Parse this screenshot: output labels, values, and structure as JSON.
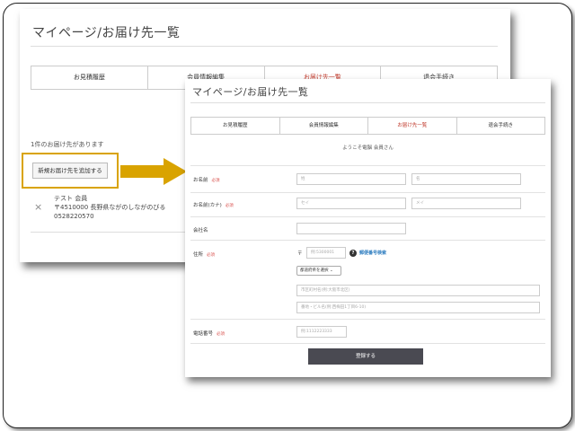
{
  "back": {
    "title": "マイページ/お届け先一覧",
    "tabs": [
      {
        "label": "お見積履歴",
        "active": false
      },
      {
        "label": "会員情報編集",
        "active": false
      },
      {
        "label": "お届け先一覧",
        "active": true
      },
      {
        "label": "退会手続き",
        "active": false
      }
    ],
    "count_text": "1件のお届け先があります",
    "add_button_label": "新規お届け先を追加する",
    "remove_icon": "×",
    "address": {
      "name": "テスト 会員",
      "address_line": "〒4510000 長野県ながのしながのびる",
      "phone": "0528220570"
    }
  },
  "front": {
    "title": "マイページ/お届け先一覧",
    "tabs": [
      {
        "label": "お見積履歴",
        "active": false
      },
      {
        "label": "会員情報編集",
        "active": false
      },
      {
        "label": "お届け先一覧",
        "active": true
      },
      {
        "label": "退会手続き",
        "active": false
      }
    ],
    "welcome": "ようこそ電脳 会員さん",
    "required_label": "必須",
    "form": {
      "name_label": "お名前",
      "name_sei_placeholder": "姓",
      "name_mei_placeholder": "名",
      "kana_label": "お名前(カナ)",
      "kana_sei_placeholder": "セイ",
      "kana_mei_placeholder": "メイ",
      "company_label": "会社名",
      "address_label": "住所",
      "zip_mark": "〒",
      "zip_placeholder": "例:5300001",
      "help_icon": "?",
      "zip_search_link": "郵便番号検索",
      "pref_select": "都道府県を選択",
      "city_placeholder": "市区町村名(例:大阪市北区)",
      "street_placeholder": "番地・ビル名(例:西梅田1丁目6-10)",
      "phone_label": "電話番号",
      "phone_placeholder": "例:1112223333"
    },
    "submit_label": "登録する"
  },
  "colors": {
    "accent_red": "#c0392b",
    "highlight_gold": "#d9a300",
    "arrow_gold": "#d9a300",
    "submit_bg": "#4a4a52",
    "link_blue": "#2a7bbf"
  }
}
